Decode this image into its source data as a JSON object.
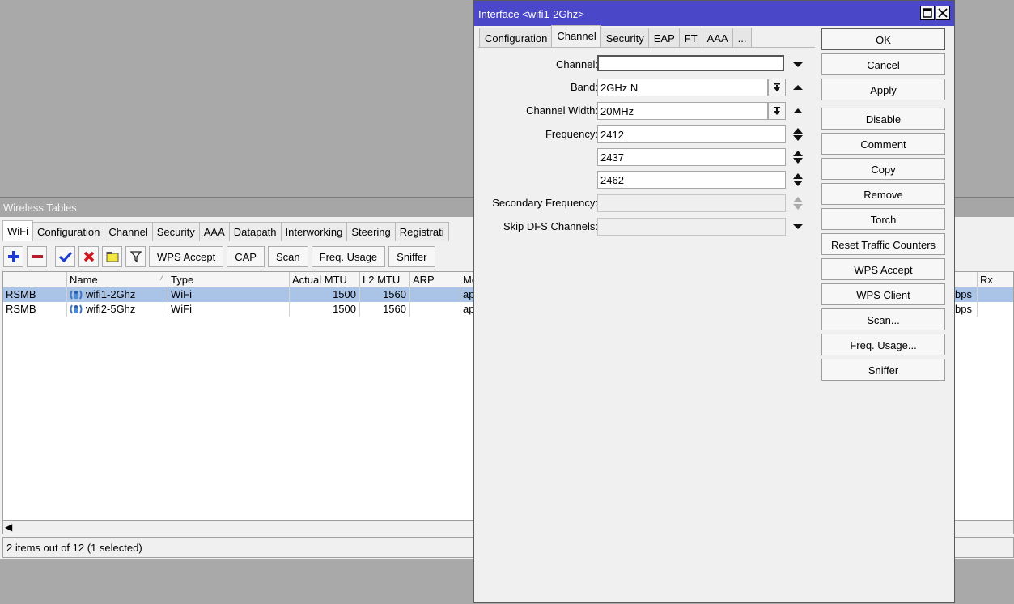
{
  "wireless_tables": {
    "title": "Wireless Tables",
    "tabs": [
      "WiFi",
      "Configuration",
      "Channel",
      "Security",
      "AAA",
      "Datapath",
      "Interworking",
      "Steering",
      "Registrati"
    ],
    "toolbar": {
      "buttons": [
        "WPS Accept",
        "CAP",
        "Scan",
        "Freq. Usage",
        "Sniffer"
      ],
      "icons": [
        "add-icon",
        "remove-icon",
        "enable-check-icon",
        "disable-x-icon",
        "comment-note-icon",
        "filter-icon"
      ]
    },
    "columns": [
      "Name",
      "Type",
      "Actual MTU",
      "L2 MTU",
      "ARP",
      "Mo",
      "Rx"
    ],
    "rows": [
      {
        "flags": "RSMB",
        "name": "wifi1-2Ghz",
        "type": "WiFi",
        "actual_mtu": "1500",
        "l2_mtu": "1560",
        "arp": "",
        "mode": "ap",
        "rx": "bps",
        "selected": true
      },
      {
        "flags": "RSMB",
        "name": "wifi2-5Ghz",
        "type": "WiFi",
        "actual_mtu": "1500",
        "l2_mtu": "1560",
        "arp": "",
        "mode": "ap",
        "rx": "bps",
        "selected": false
      }
    ],
    "status": "2 items out of 12 (1 selected)"
  },
  "dialog": {
    "title": "Interface <wifi1-2Ghz>",
    "tabs": [
      "Configuration",
      "Channel",
      "Security",
      "EAP",
      "FT",
      "AAA",
      "..."
    ],
    "active_tab": "Channel",
    "fields": {
      "channel": {
        "label": "Channel:",
        "value": ""
      },
      "band": {
        "label": "Band:",
        "value": "2GHz N"
      },
      "channel_width": {
        "label": "Channel Width:",
        "value": "20MHz"
      },
      "frequency": {
        "label": "Frequency:",
        "values": [
          "2412",
          "2437",
          "2462"
        ]
      },
      "secondary_frequency": {
        "label": "Secondary Frequency:",
        "value": ""
      },
      "skip_dfs_channels": {
        "label": "Skip DFS Channels:",
        "value": ""
      }
    },
    "buttons": [
      "OK",
      "Cancel",
      "Apply",
      "Disable",
      "Comment",
      "Copy",
      "Remove",
      "Torch",
      "Reset Traffic Counters",
      "WPS Accept",
      "WPS Client",
      "Scan...",
      "Freq. Usage...",
      "Sniffer"
    ]
  },
  "colors": {
    "desktop": "#a9a9a9",
    "dialog_title_bar": "#4b47c9",
    "selected_row": "#aac4e8",
    "add_icon": "#1a3ccc",
    "remove_icon": "#b3202a"
  }
}
